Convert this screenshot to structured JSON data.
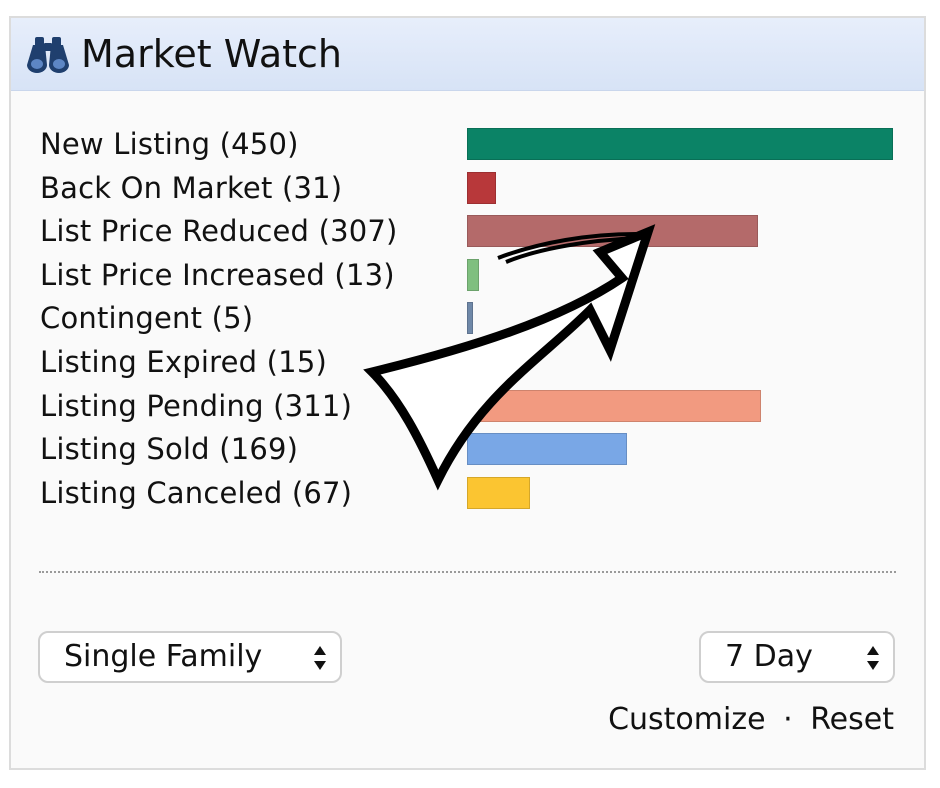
{
  "widget": {
    "title": "Market Watch",
    "icon": "binoculars-icon"
  },
  "listings": [
    {
      "label": "New Listing (450)",
      "count": 450,
      "color": "#0b8366"
    },
    {
      "label": "Back On Market (31)",
      "count": 31,
      "color": "#b8383a"
    },
    {
      "label": "List Price Reduced (307)",
      "count": 307,
      "color": "#b46a6a"
    },
    {
      "label": "List Price Increased (13)",
      "count": 13,
      "color": "#7fbf7f"
    },
    {
      "label": "Contingent (5)",
      "count": 5,
      "color": "#6f88a8"
    },
    {
      "label": "Listing Expired (15)",
      "count": 15,
      "color": "#b9b9b9"
    },
    {
      "label": "Listing Pending (311)",
      "count": 311,
      "color": "#f29a80"
    },
    {
      "label": "Listing Sold (169)",
      "count": 169,
      "color": "#79a7e6"
    },
    {
      "label": "Listing Canceled (67)",
      "count": 67,
      "color": "#fbc531"
    }
  ],
  "max_count": 450,
  "filters": {
    "property_type": "Single Family",
    "time_range": "7 Day"
  },
  "links": {
    "customize": "Customize",
    "separator": "·",
    "reset": "Reset"
  },
  "annotation": {
    "type": "curved-arrow-overlay",
    "color": "#ffffff",
    "outline": "#000000"
  }
}
